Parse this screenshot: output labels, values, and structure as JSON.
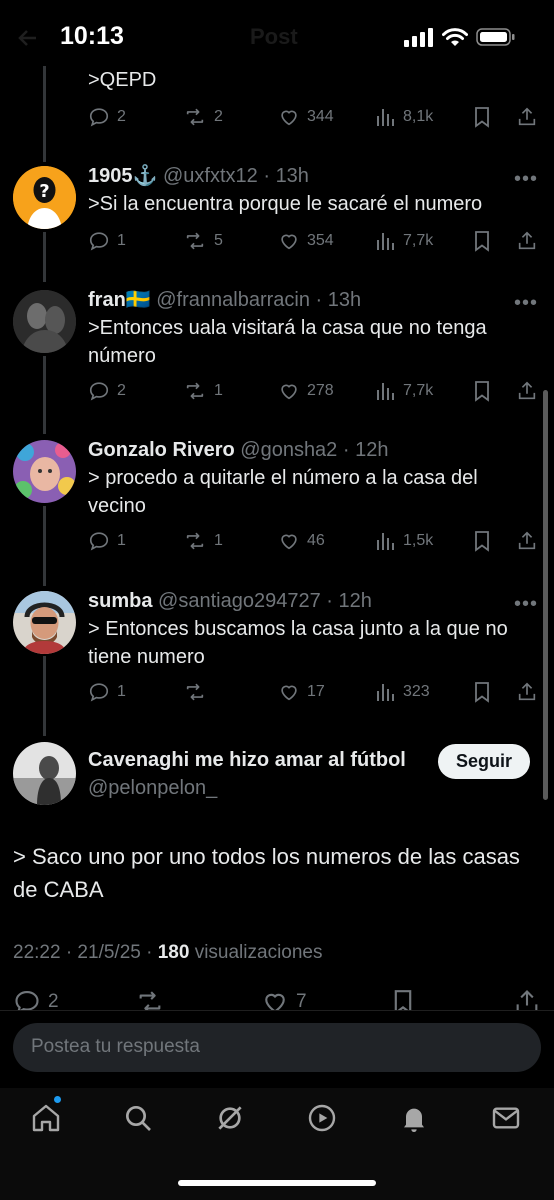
{
  "status_bar": {
    "time": "10:13",
    "header_title": "Post"
  },
  "replies": [
    {
      "text": ">QEPD",
      "stats": {
        "replies": "2",
        "reposts": "2",
        "likes": "344",
        "views": "8,1k"
      }
    },
    {
      "name": "1905⚓",
      "handle": "@uxfxtx12",
      "time": "13h",
      "text": ">Si la encuentra porque le sacaré el numero",
      "stats": {
        "replies": "1",
        "reposts": "5",
        "likes": "354",
        "views": "7,7k"
      }
    },
    {
      "name": "fran🇸🇪",
      "handle": "@frannalbarracin",
      "time": "13h",
      "text": ">Entonces uala visitará la casa que no tenga número",
      "stats": {
        "replies": "2",
        "reposts": "1",
        "likes": "278",
        "views": "7,7k"
      }
    },
    {
      "name": "Gonzalo Rivero",
      "handle": "@gonsha2",
      "time": "12h",
      "text": "> procedo a quitarle el número a la casa del vecino",
      "stats": {
        "replies": "1",
        "reposts": "1",
        "likes": "46",
        "views": "1,5k"
      }
    },
    {
      "name": "sumba",
      "handle": "@santiago294727",
      "time": "12h",
      "text": "> Entonces buscamos la casa junto a la que no tiene numero",
      "stats": {
        "replies": "1",
        "reposts": "",
        "likes": "17",
        "views": "323"
      }
    }
  ],
  "main_post": {
    "name": "Cavenaghi me hizo amar al fútbol",
    "handle": "@pelonpelon_",
    "follow_label": "Seguir",
    "text": "> Saco uno por uno todos los numeros de las casas de CABA",
    "date": "22:22 · 21/5/25 ·",
    "views_count": "180",
    "views_label": "visualizaciones",
    "stats": {
      "replies": "2",
      "likes": "7"
    }
  },
  "reply_input": {
    "placeholder": "Postea tu respuesta"
  },
  "tabbar": {
    "items": [
      "home-icon",
      "search-icon",
      "grok-icon",
      "video-icon",
      "notifications-icon",
      "messages-icon"
    ]
  },
  "colors": {
    "background": "#000000",
    "text": "#e7e9ea",
    "muted": "#71767b",
    "accent": "#1d9bf0",
    "input_bg": "#202327"
  }
}
